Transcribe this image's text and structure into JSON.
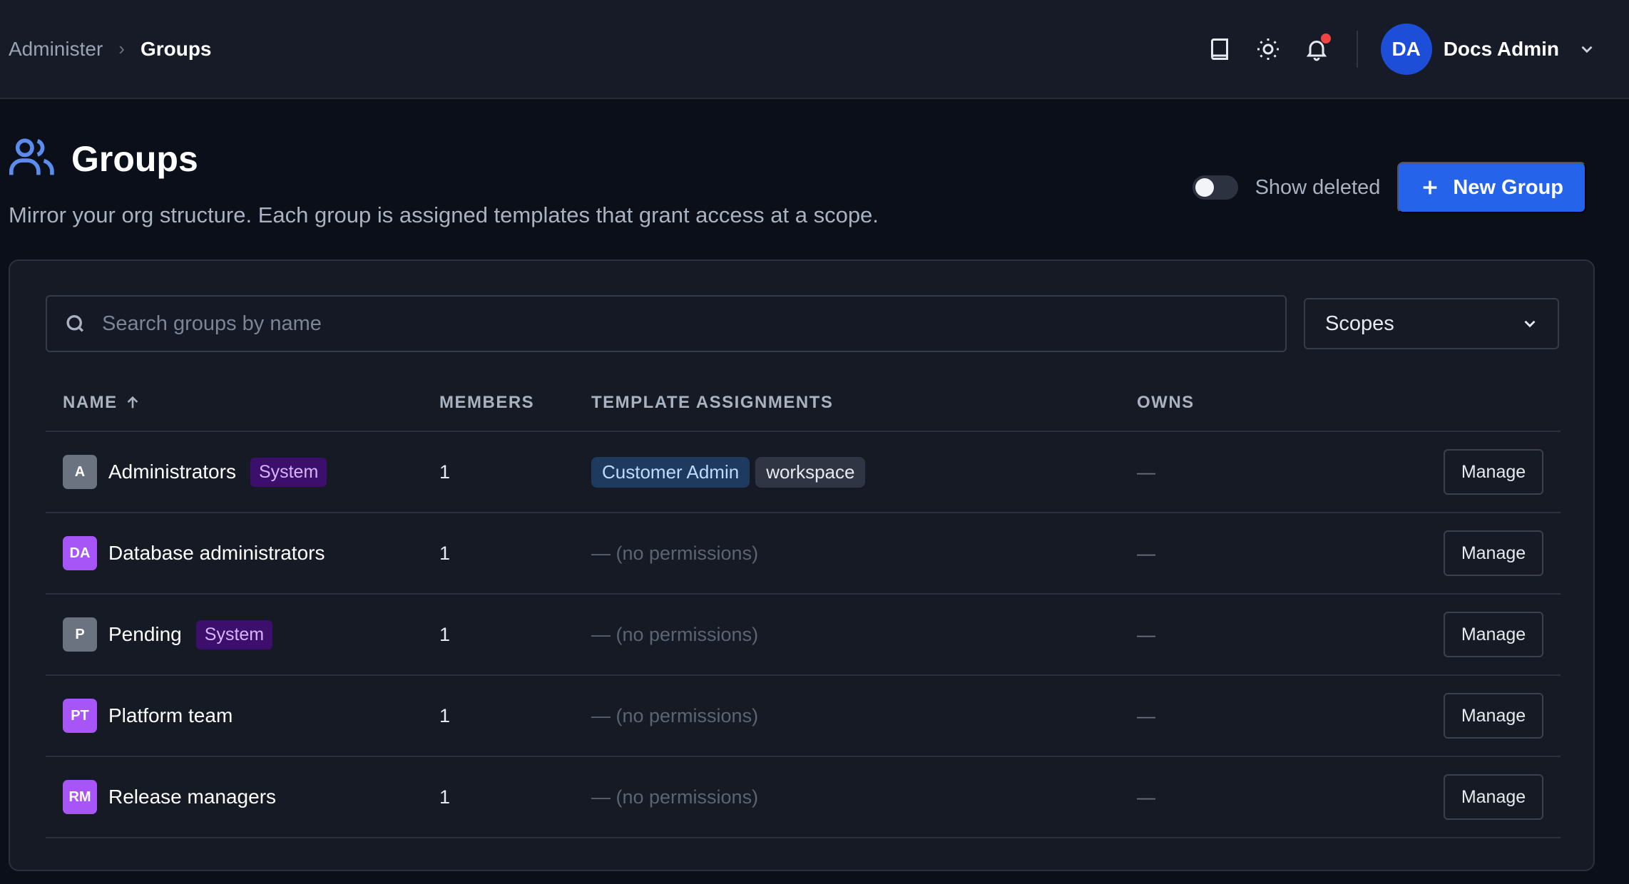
{
  "breadcrumb": {
    "parent": "Administer",
    "separator": "›",
    "current": "Groups"
  },
  "user": {
    "initials": "DA",
    "name": "Docs Admin"
  },
  "page": {
    "title": "Groups",
    "subtitle": "Mirror your org structure. Each group is assigned templates that grant access at a scope.",
    "show_deleted_label": "Show deleted",
    "new_group_label": "New Group"
  },
  "search": {
    "placeholder": "Search groups by name"
  },
  "scopes": {
    "label": "Scopes"
  },
  "table": {
    "headers": {
      "name": "NAME",
      "members": "MEMBERS",
      "templates": "TEMPLATE ASSIGNMENTS",
      "owns": "OWNS"
    },
    "rows": [
      {
        "initials": "A",
        "name": "Administrators",
        "badge": "System",
        "members": "1",
        "template": "Customer Admin",
        "scope": "workspace",
        "owns": "—",
        "action": "Manage"
      },
      {
        "initials": "DA",
        "name": "Database administrators",
        "members": "1",
        "no_perm": "— (no permissions)",
        "owns": "—",
        "action": "Manage"
      },
      {
        "initials": "P",
        "name": "Pending",
        "badge": "System",
        "members": "1",
        "no_perm": "— (no permissions)",
        "owns": "—",
        "action": "Manage"
      },
      {
        "initials": "PT",
        "name": "Platform team",
        "members": "1",
        "no_perm": "— (no permissions)",
        "owns": "—",
        "action": "Manage"
      },
      {
        "initials": "RM",
        "name": "Release managers",
        "members": "1",
        "no_perm": "— (no permissions)",
        "owns": "—",
        "action": "Manage"
      }
    ]
  },
  "colors": {
    "accent": "#2563eb",
    "system_badge": "#3b0f6b",
    "group_avatar_purple": "#a855f7",
    "group_avatar_gray": "#6b7280",
    "notification": "#ef4444"
  }
}
